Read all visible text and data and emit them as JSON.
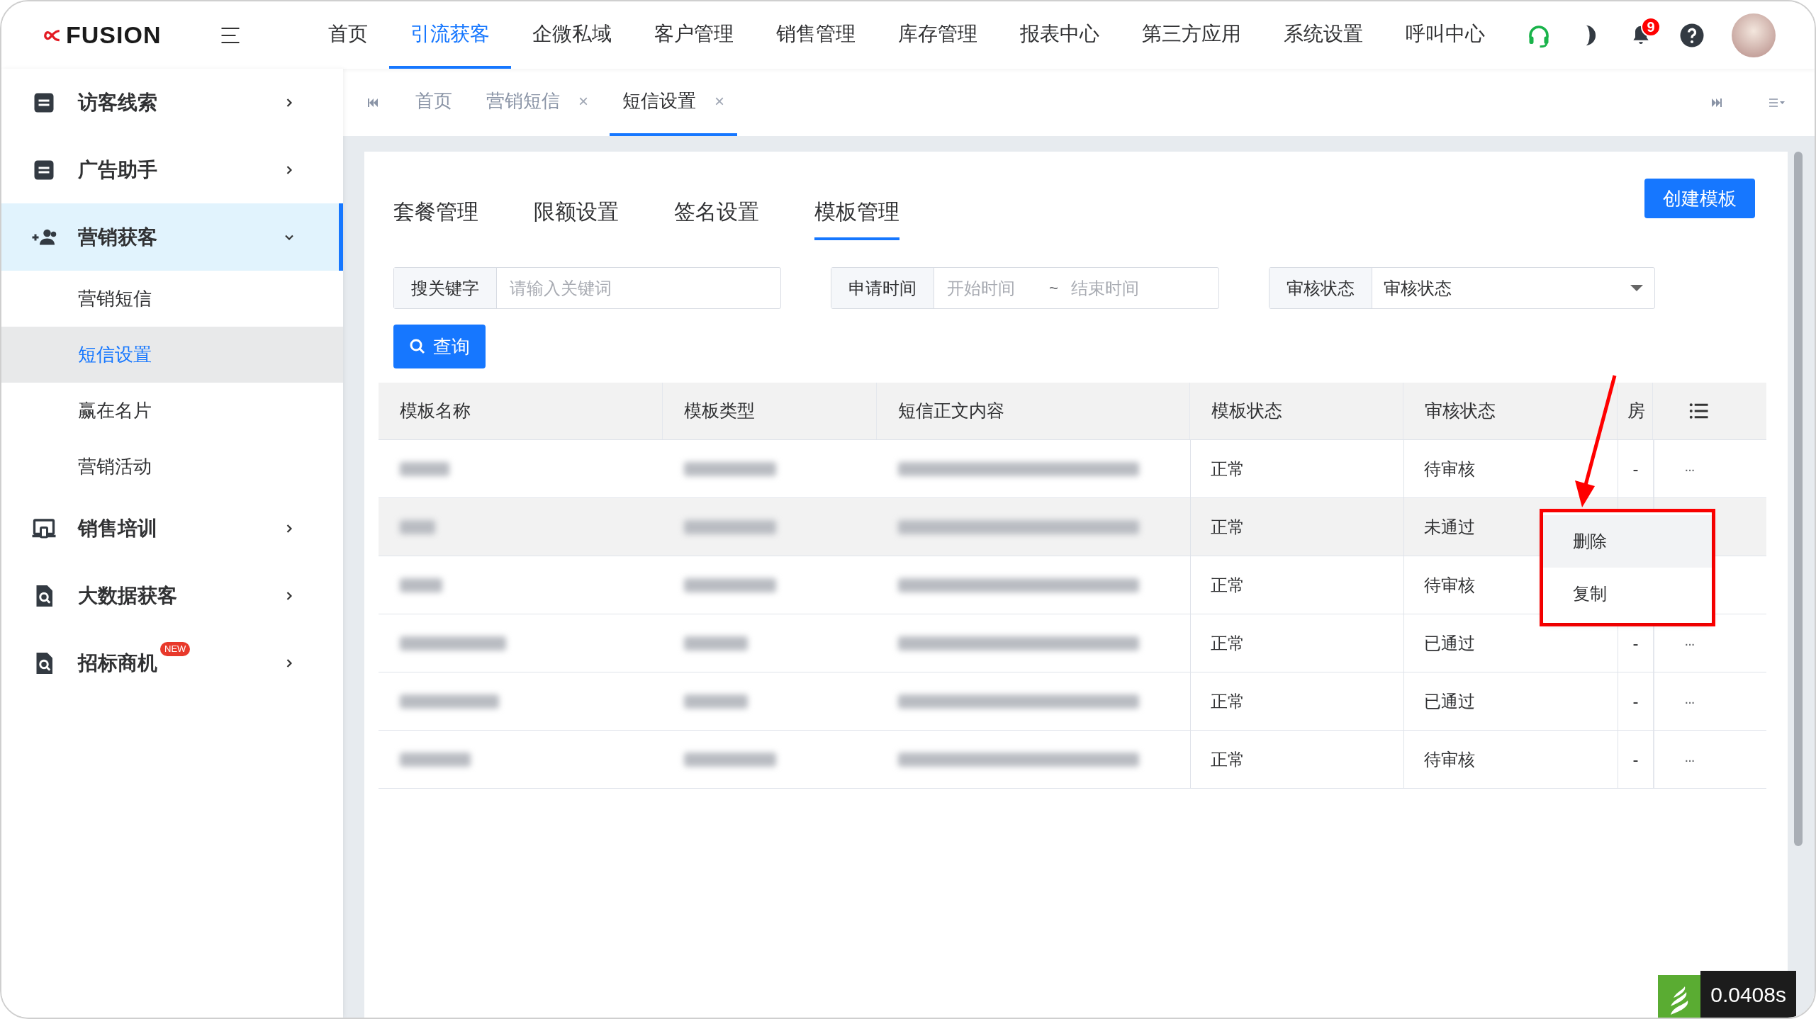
{
  "logo": {
    "text": "FUSION"
  },
  "top_nav": [
    {
      "label": "首页",
      "selected": false
    },
    {
      "label": "引流获客",
      "selected": true
    },
    {
      "label": "企微私域",
      "selected": false
    },
    {
      "label": "客户管理",
      "selected": false
    },
    {
      "label": "销售管理",
      "selected": false
    },
    {
      "label": "库存管理",
      "selected": false
    },
    {
      "label": "报表中心",
      "selected": false
    },
    {
      "label": "第三方应用",
      "selected": false
    },
    {
      "label": "系统设置",
      "selected": false
    },
    {
      "label": "呼叫中心",
      "selected": false
    }
  ],
  "notifications": {
    "count": "9"
  },
  "sidebar": {
    "items": [
      {
        "label": "访客线索",
        "expanded": false,
        "selected": false
      },
      {
        "label": "广告助手",
        "expanded": false,
        "selected": false
      },
      {
        "label": "营销获客",
        "expanded": true,
        "selected": true,
        "children": [
          {
            "label": "营销短信",
            "selected": false
          },
          {
            "label": "短信设置",
            "selected": true
          },
          {
            "label": "赢在名片",
            "selected": false
          },
          {
            "label": "营销活动",
            "selected": false
          }
        ]
      },
      {
        "label": "销售培训",
        "expanded": false,
        "selected": false
      },
      {
        "label": "大数据获客",
        "expanded": false,
        "selected": false
      },
      {
        "label": "招标商机",
        "expanded": false,
        "selected": false,
        "badge": "NEW"
      }
    ]
  },
  "page_tabs": [
    {
      "label": "首页",
      "selected": false,
      "closable": false
    },
    {
      "label": "营销短信",
      "selected": false,
      "closable": true
    },
    {
      "label": "短信设置",
      "selected": true,
      "closable": true
    }
  ],
  "close_mark": "×",
  "sub_tabs": [
    {
      "label": "套餐管理",
      "selected": false
    },
    {
      "label": "限额设置",
      "selected": false
    },
    {
      "label": "签名设置",
      "selected": false
    },
    {
      "label": "模板管理",
      "selected": true
    }
  ],
  "create_button": "创建模板",
  "filters": {
    "keyword": {
      "label": "搜关键字",
      "placeholder": "请输入关键词"
    },
    "date": {
      "label": "申请时间",
      "start_placeholder": "开始时间",
      "separator": "~",
      "end_placeholder": "结束时间"
    },
    "audit": {
      "label": "审核状态",
      "value": "审核状态"
    }
  },
  "query_button": "查询",
  "table": {
    "columns": [
      "模板名称",
      "模板类型",
      "短信正文内容",
      "模板状态",
      "审核状态",
      "房"
    ],
    "rows": [
      {
        "template_state": "正常",
        "audit_state": "待审核",
        "column_6": "-",
        "actions": "···",
        "highlighted": false
      },
      {
        "template_state": "正常",
        "audit_state": "未通过",
        "highlighted": true
      },
      {
        "template_state": "正常",
        "audit_state": "待审核",
        "highlighted": false
      },
      {
        "template_state": "正常",
        "audit_state": "已通过",
        "column_6": "-",
        "actions": "···",
        "highlighted": false
      },
      {
        "template_state": "正常",
        "audit_state": "已通过",
        "column_6": "-",
        "actions": "···",
        "highlighted": false
      },
      {
        "template_state": "正常",
        "audit_state": "待审核",
        "column_6": "-",
        "actions": "···",
        "highlighted": false
      }
    ]
  },
  "action_menu": [
    {
      "label": "删除",
      "selected": true
    },
    {
      "label": "复制",
      "selected": false
    }
  ],
  "timer": "0.0408s"
}
